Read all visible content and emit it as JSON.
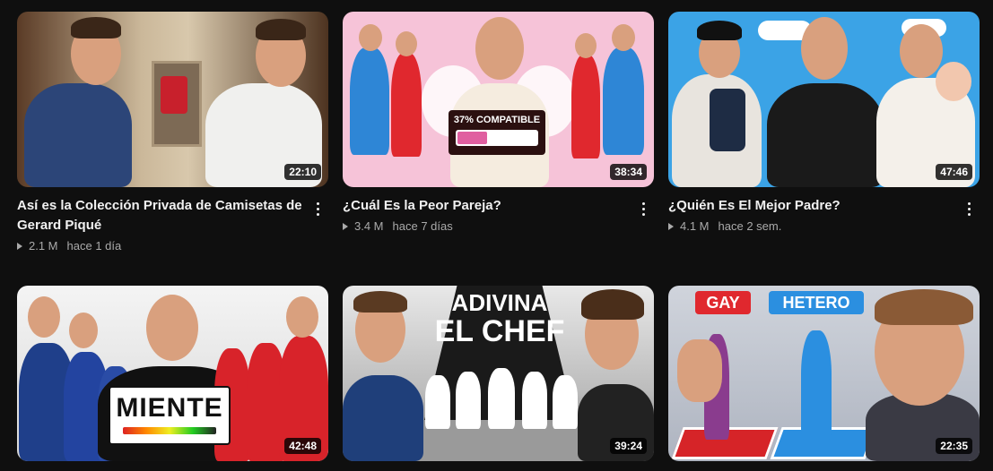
{
  "videos": [
    {
      "title": "Así es la Colección Privada de Camisetas de Gerard Piqué",
      "views": "2.1 M",
      "age": "hace 1 día",
      "duration": "22:10"
    },
    {
      "title": "¿Cuál Es la Peor Pareja?",
      "views": "3.4 M",
      "age": "hace 7 días",
      "duration": "38:34",
      "thumb_text": "37% COMPATIBLE",
      "compat_level": 0.37
    },
    {
      "title": "¿Quién Es El Mejor Padre?",
      "views": "4.1 M",
      "age": "hace 2 sem.",
      "duration": "47:46"
    },
    {
      "title": "",
      "views": "",
      "age": "",
      "duration": "42:48",
      "thumb_text": "MIENTE"
    },
    {
      "title": "",
      "views": "",
      "age": "",
      "duration": "39:24",
      "thumb_text_1": "ADIVINA",
      "thumb_text_2": "EL CHEF"
    },
    {
      "title": "",
      "views": "",
      "age": "",
      "duration": "22:35",
      "thumb_text_1": "GAY",
      "thumb_text_2": "HETERO"
    }
  ],
  "colors": {
    "background": "#0f0f0f",
    "meta": "#aaaaaa",
    "accent_pink": "#f7c6dc",
    "red": "#e0282e",
    "blue": "#2b8fe0"
  },
  "icons": {
    "menu": "more-vert-icon",
    "views": "play-icon"
  }
}
